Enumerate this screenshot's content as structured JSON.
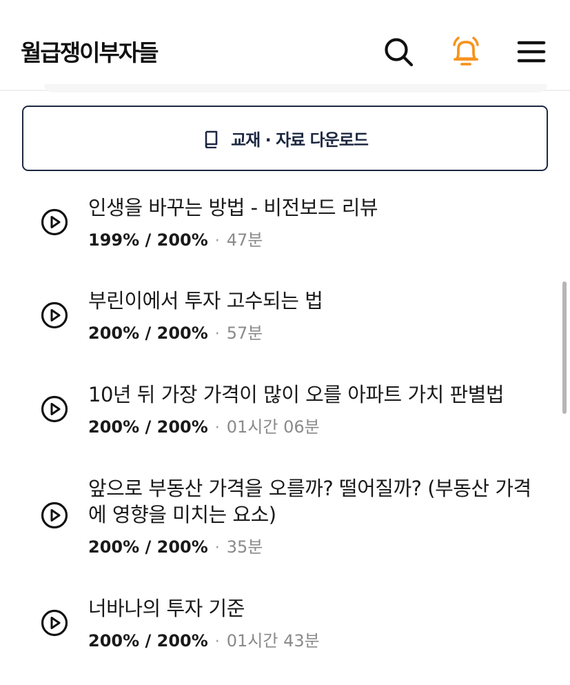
{
  "header": {
    "logo": "월급쟁이부자들",
    "search_icon": "search-icon",
    "bell_icon": "bell-icon",
    "menu_icon": "hamburger-menu-icon",
    "bell_color": "#F7931E"
  },
  "download": {
    "icon": "book-icon",
    "label": "교재 · 자료 다운로드"
  },
  "lessons": [
    {
      "title": "인생을 바꾸는 방법 - 비전보드 리뷰",
      "progress": "199% / 200%",
      "duration": "47분"
    },
    {
      "title": "부린이에서 투자 고수되는 법",
      "progress": "200% / 200%",
      "duration": "57분"
    },
    {
      "title": "10년 뒤 가장 가격이 많이 오를 아파트 가치 판별법",
      "progress": "200% / 200%",
      "duration": "01시간 06분"
    },
    {
      "title": "앞으로 부동산 가격을 오를까? 떨어질까? (부동산 가격에 영향을 미치는 요소)",
      "progress": "200% / 200%",
      "duration": "35분"
    },
    {
      "title": "너바나의 투자 기준",
      "progress": "200% / 200%",
      "duration": "01시간 43분"
    }
  ],
  "separator": "·",
  "colors": {
    "accent": "#F7931E",
    "navy": "#1D2741",
    "muted": "#8A8A8A"
  }
}
